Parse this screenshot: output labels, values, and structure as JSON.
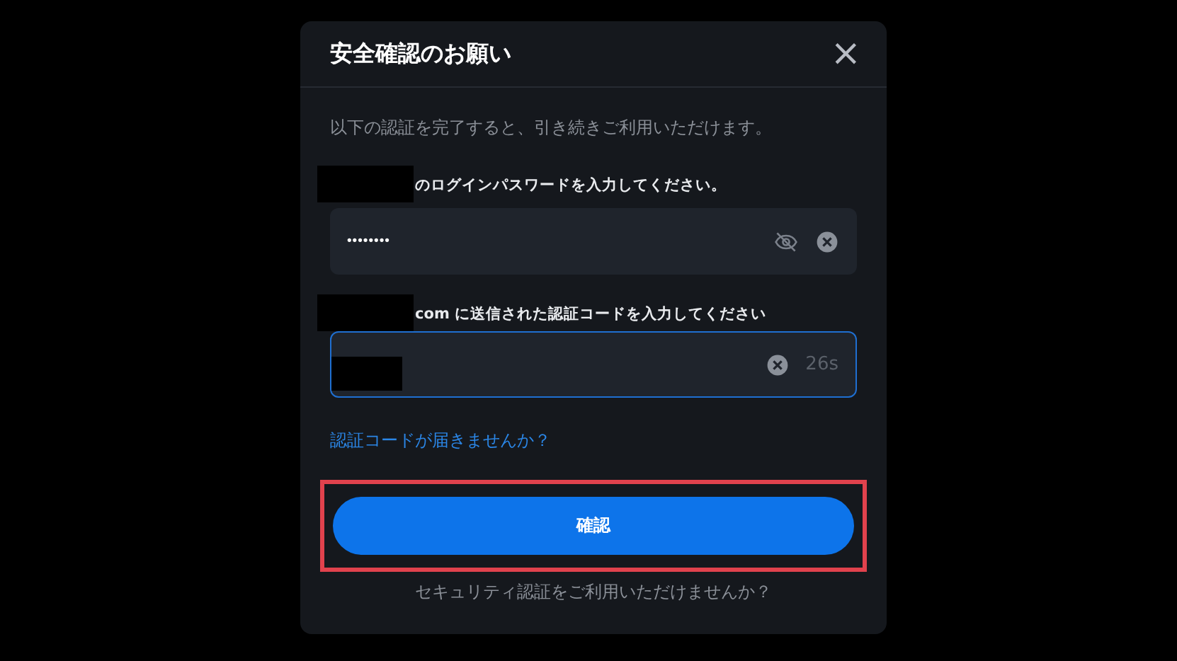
{
  "dialog": {
    "title": "安全確認のお願い",
    "close": "×"
  },
  "subtitle": "以下の認証を完了すると、引き続きご利用いただけます。",
  "fields": [
    {
      "label": "のログインパスワードを入力してください。",
      "label_redacted": true,
      "value": "••••••••",
      "focused": false,
      "eye": true,
      "clear": true
    },
    {
      "label": "com に送信された認証コードを入力してください",
      "label_redacted": true,
      "value_redacted": true,
      "focused": true,
      "clear": true,
      "timer": "26s"
    }
  ],
  "resend_link": "認証コードが届きませんか？",
  "confirm_button": {
    "label": "確認",
    "highlighted": true
  },
  "security_link": "セキュリティ認証をご利用いただけませんか？"
}
